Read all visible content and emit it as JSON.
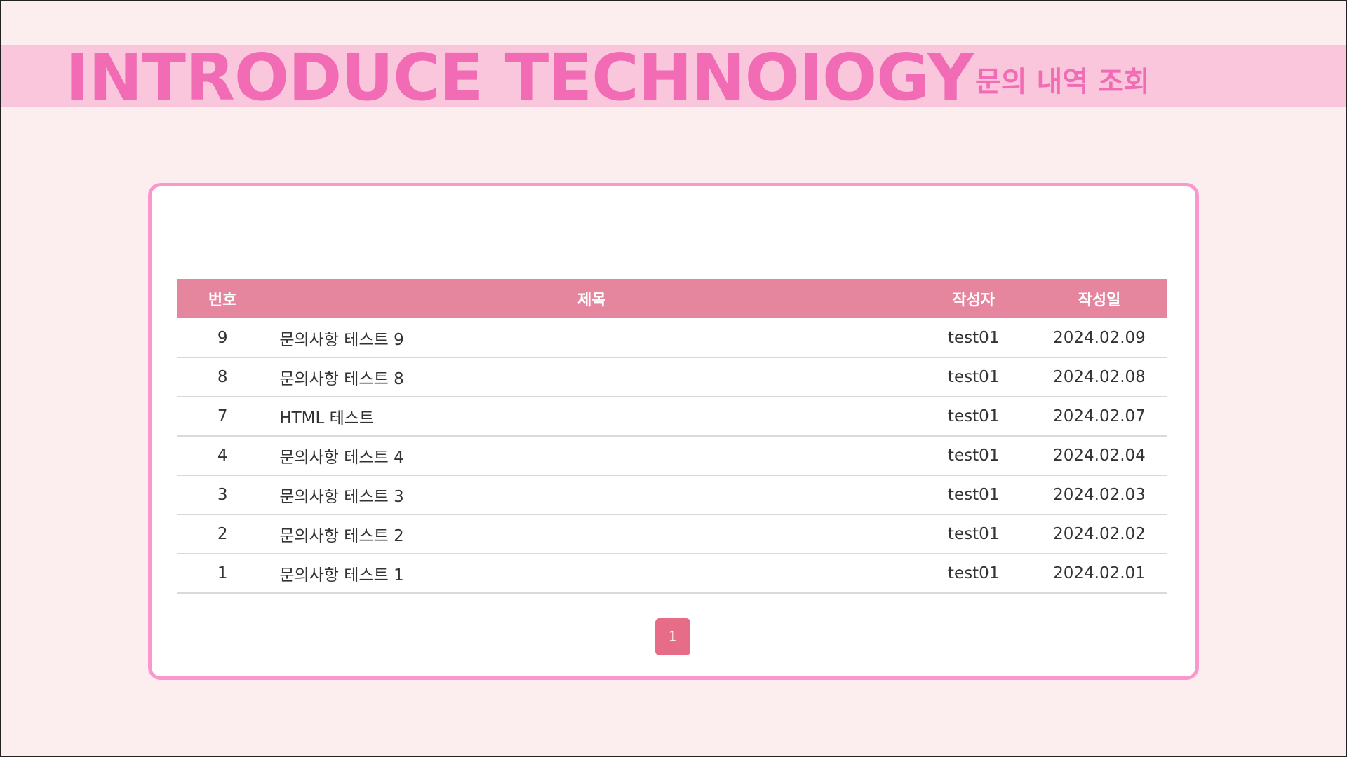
{
  "header": {
    "title": "INTRODUCE TECHNOIOGY",
    "subtitle": "문의 내역 조회"
  },
  "table": {
    "columns": {
      "number": "번호",
      "title": "제목",
      "author": "작성자",
      "date": "작성일"
    },
    "rows": [
      {
        "number": "9",
        "title": "문의사항 테스트 9",
        "author": "test01",
        "date": "2024.02.09"
      },
      {
        "number": "8",
        "title": "문의사항 테스트 8",
        "author": "test01",
        "date": "2024.02.08"
      },
      {
        "number": "7",
        "title": "HTML 테스트",
        "author": "test01",
        "date": "2024.02.07"
      },
      {
        "number": "4",
        "title": "문의사항 테스트 4",
        "author": "test01",
        "date": "2024.02.04"
      },
      {
        "number": "3",
        "title": "문의사항 테스트 3",
        "author": "test01",
        "date": "2024.02.03"
      },
      {
        "number": "2",
        "title": "문의사항 테스트 2",
        "author": "test01",
        "date": "2024.02.02"
      },
      {
        "number": "1",
        "title": "문의사항 테스트 1",
        "author": "test01",
        "date": "2024.02.01"
      }
    ]
  },
  "pagination": {
    "current_page": "1"
  },
  "colors": {
    "page_background": "#fcedee",
    "banner_background": "#f9c6dc",
    "accent_pink": "#f26bb5",
    "card_border": "#fa98cd",
    "table_header": "#e5869e",
    "page_button": "#e76c87"
  }
}
